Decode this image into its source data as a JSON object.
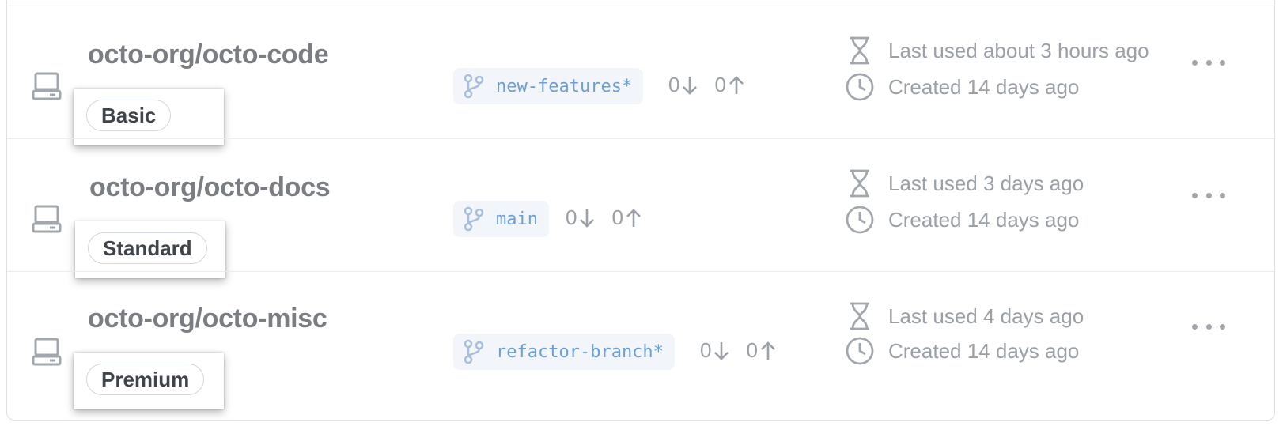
{
  "rows": [
    {
      "repo": "octo-org/octo-code",
      "machine_type": "Basic",
      "branch": "new-features",
      "branch_dirty": "*",
      "behind": "0",
      "ahead": "0",
      "last_used": "Last used about 3 hours ago",
      "created": "Created 14 days ago"
    },
    {
      "repo": "octo-org/octo-docs",
      "machine_type": "Standard",
      "branch": "main",
      "branch_dirty": "",
      "behind": "0",
      "ahead": "0",
      "last_used": "Last used 3 days ago",
      "created": "Created 14 days ago"
    },
    {
      "repo": "octo-org/octo-misc",
      "machine_type": "Premium",
      "branch": "refactor-branch",
      "branch_dirty": "*",
      "behind": "0",
      "ahead": "0",
      "last_used": "Last used 4 days ago",
      "created": "Created 14 days ago"
    }
  ],
  "icons": {
    "row": "codespace-computer-icon",
    "branch": "git-branch-icon",
    "behind": "arrow-down-icon",
    "ahead": "arrow-up-icon",
    "last_used": "hourglass-icon",
    "created": "clock-icon",
    "more": "kebab-horizontal-icon"
  },
  "colors": {
    "repo_text": "#7a7d82",
    "branch_text": "#6c9fd6",
    "branch_bg": "#f2f6fb",
    "muted": "#9aa0a6",
    "border": "#dde1e6"
  }
}
